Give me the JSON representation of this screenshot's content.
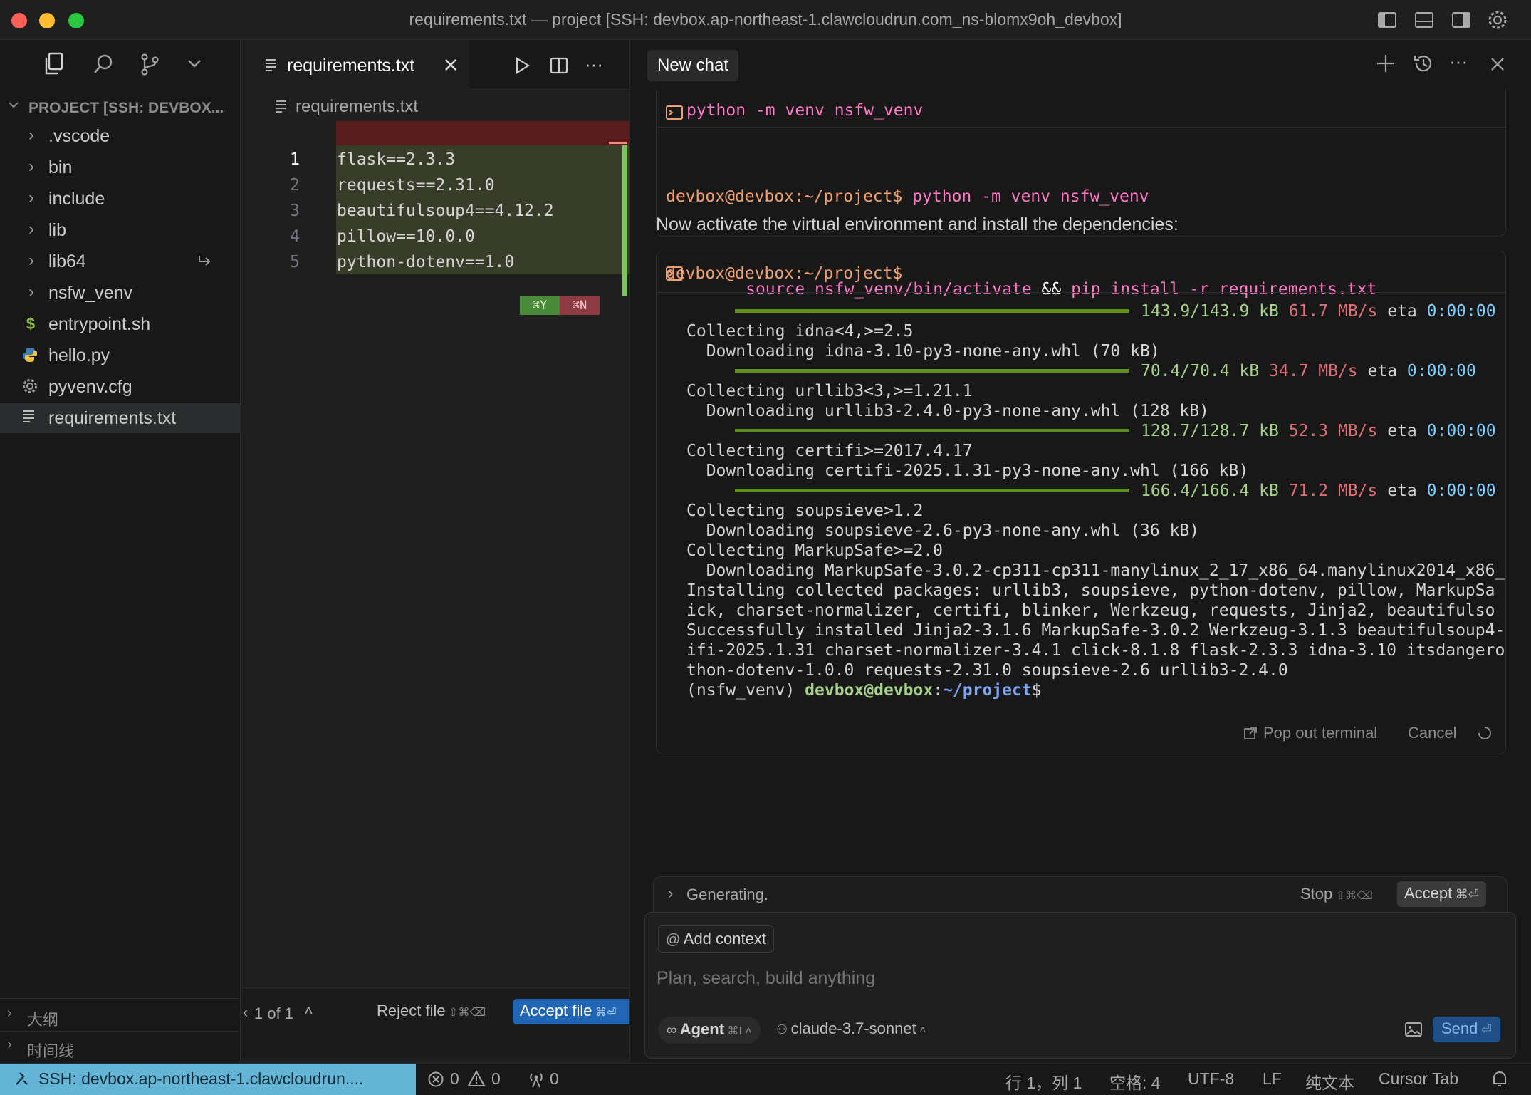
{
  "window": {
    "title": "requirements.txt — project [SSH: devbox.ap-northeast-1.clawcloudrun.com_ns-blomx9oh_devbox]"
  },
  "sidebar": {
    "header": "PROJECT [SSH: DEVBOX...",
    "items": [
      {
        "label": ".vscode",
        "kind": "folder"
      },
      {
        "label": "bin",
        "kind": "folder"
      },
      {
        "label": "include",
        "kind": "folder"
      },
      {
        "label": "lib",
        "kind": "folder"
      },
      {
        "label": "lib64",
        "kind": "folder-link"
      },
      {
        "label": "nsfw_venv",
        "kind": "folder"
      },
      {
        "label": "entrypoint.sh",
        "kind": "shell",
        "icon": "$"
      },
      {
        "label": "hello.py",
        "kind": "python"
      },
      {
        "label": "pyvenv.cfg",
        "kind": "config"
      },
      {
        "label": "requirements.txt",
        "kind": "text"
      }
    ],
    "outline_label": "大纲",
    "timeline_label": "时间线"
  },
  "editor": {
    "tab_label": "requirements.txt",
    "breadcrumb": "requirements.txt",
    "lines": [
      {
        "num": "1",
        "text": "flask==2.3.3"
      },
      {
        "num": "2",
        "text": "requests==2.31.0"
      },
      {
        "num": "3",
        "text": "beautifulsoup4==4.12.2"
      },
      {
        "num": "4",
        "text": "pillow==10.0.0"
      },
      {
        "num": "5",
        "text": "python-dotenv==1.0"
      }
    ],
    "accept_hint": "⌘Y",
    "reject_hint": "⌘N",
    "diff_nav": "1 of 1",
    "reject_file": "Reject file",
    "reject_shortcut": "⇧⌘⌫",
    "accept_file": "Accept file",
    "accept_shortcut": "⌘⏎"
  },
  "chat": {
    "tab_label": "New chat",
    "cmd1_label": "python -m venv nsfw_venv",
    "prompt1a": "devbox@devbox:~/project$",
    "cmd1_echo": " python -m venv nsfw_venv",
    "prompt1b": "devbox@devbox:~/project$",
    "message": "Now activate the virtual environment and install the dependencies:",
    "cmd2": {
      "p1": "source",
      "p2": " nsfw_venv/bin/activate ",
      "p3": "&&",
      "p4": " pip",
      "p5": " install -r requirements.txt"
    },
    "progress": [
      {
        "size": "143.9/143.9 kB",
        "speed": "61.7 MB/s",
        "eta_label": "eta",
        "eta": "0:00:00"
      },
      {
        "size": "70.4/70.4 kB",
        "speed": "34.7 MB/s",
        "eta_label": "eta",
        "eta": "0:00:00"
      },
      {
        "size": "128.7/128.7 kB",
        "speed": "52.3 MB/s",
        "eta_label": "eta",
        "eta": "0:00:00"
      },
      {
        "size": "166.4/166.4 kB",
        "speed": "71.2 MB/s",
        "eta_label": "eta",
        "eta": "0:00:00"
      }
    ],
    "out": [
      "Collecting idna<4,>=2.5",
      "  Downloading idna-3.10-py3-none-any.whl (70 kB)",
      "Collecting urllib3<3,>=1.21.1",
      "  Downloading urllib3-2.4.0-py3-none-any.whl (128 kB)",
      "Collecting certifi>=2017.4.17",
      "  Downloading certifi-2025.1.31-py3-none-any.whl (166 kB)",
      "Collecting soupsieve>1.2",
      "  Downloading soupsieve-2.6-py3-none-any.whl (36 kB)",
      "Collecting MarkupSafe>=2.0",
      "  Downloading MarkupSafe-3.0.2-cp311-cp311-manylinux_2_17_x86_64.manylinux2014_x86_",
      "Installing collected packages: urllib3, soupsieve, python-dotenv, pillow, MarkupSa",
      "ick, charset-normalizer, certifi, blinker, Werkzeug, requests, Jinja2, beautifulso",
      "Successfully installed Jinja2-3.1.6 MarkupSafe-3.0.2 Werkzeug-3.1.3 beautifulsoup4-",
      "ifi-2025.1.31 charset-normalizer-3.4.1 click-8.1.8 flask-2.3.3 idna-3.10 itsdangero",
      "thon-dotenv-1.0.0 requests-2.31.0 soupsieve-2.6 urllib3-2.4.0"
    ],
    "final_prompt": {
      "env": "(nsfw_venv) ",
      "user": "devbox@devbox",
      "sep": ":",
      "path": "~/project",
      "dollar": "$"
    },
    "pop_out": "Pop out terminal",
    "cancel": "Cancel",
    "generating": "Generating.",
    "stop": "Stop",
    "stop_shortcut": "⇧⌘⌫",
    "accept": "Accept",
    "accept_shortcut": "⌘⏎",
    "add_context": "Add context",
    "input_placeholder": "Plan, search, build anything",
    "agent": "Agent",
    "agent_shortcut": "⌘I",
    "model": "claude-3.7-sonnet",
    "send": "Send",
    "send_shortcut": "⏎"
  },
  "status": {
    "remote": "SSH: devbox.ap-northeast-1.clawcloudrun....",
    "errors": "0",
    "warnings": "0",
    "ports": "0",
    "position": "行 1，列 1",
    "spaces": "空格: 4",
    "encoding": "UTF-8",
    "eol": "LF",
    "language": "纯文本",
    "cursor_tab": "Cursor Tab"
  },
  "colors": {
    "accent": "#0078d4",
    "remote_bg": "#64b5d5",
    "prompt_pink": "#ff79c6",
    "path_blue": "#7aa2f7",
    "green": "#a6d189",
    "red": "#e06c75"
  }
}
